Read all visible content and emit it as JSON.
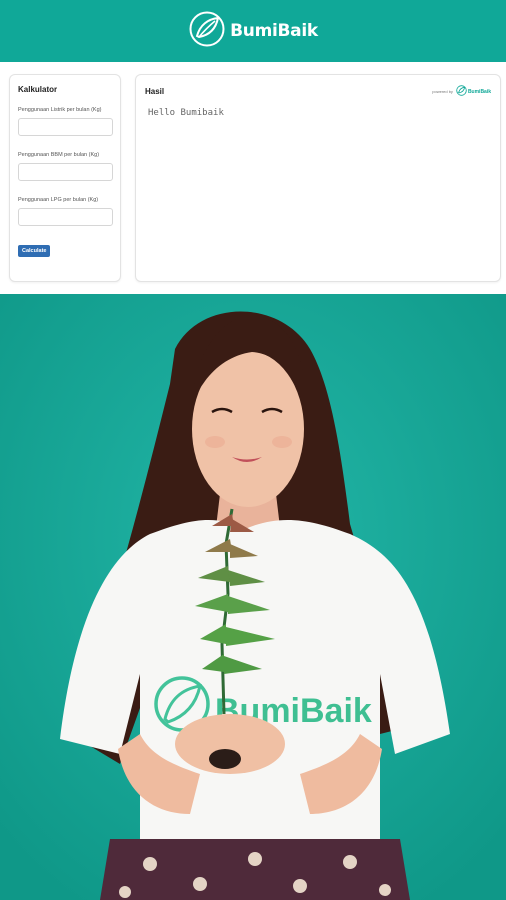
{
  "header": {
    "brand_name": "BumiBaik",
    "logo_icon": "leaf-circle-icon",
    "bg_color": "#10a898"
  },
  "calculator": {
    "title": "Kalkulator",
    "fields": [
      {
        "label": "Penggunaan Listrik per bulan (Kg)",
        "value": ""
      },
      {
        "label": "Penggunaan BBM per bulan (Kg)",
        "value": ""
      },
      {
        "label": "Penggunaan LPG per bulan (Kg)",
        "value": ""
      }
    ],
    "button_label": "Calculate",
    "button_color": "#2f6db3"
  },
  "result": {
    "title": "Hasil",
    "powered_by": "powered by",
    "powered_brand": "BumiBaik",
    "output_text": "Hello Bumibaik"
  },
  "hero": {
    "shirt_brand": "BumiBaik",
    "bg_color": "#17a799"
  }
}
